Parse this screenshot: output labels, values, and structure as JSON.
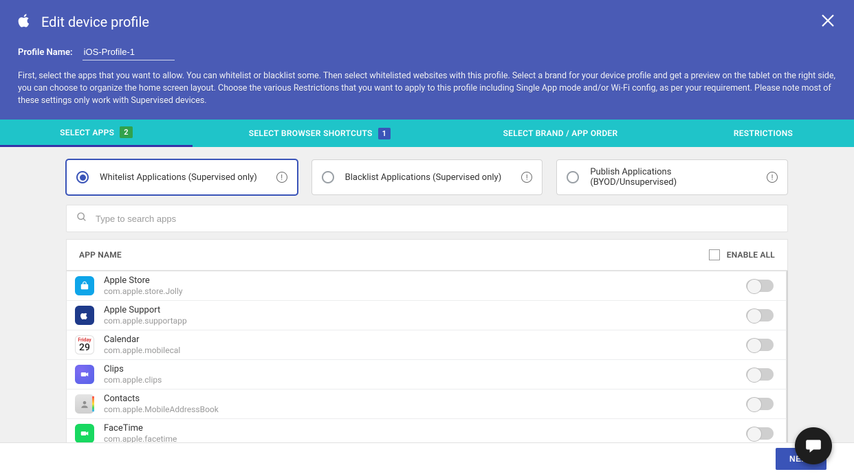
{
  "header": {
    "title": "Edit device profile",
    "profile_label": "Profile Name:",
    "profile_value": "iOS-Profile-1",
    "description": "First, select the apps that you want to allow. You can whitelist or blacklist some. Then select whitelisted websites with this profile. Select a brand for your device profile and get a preview on the tablet on the right side, you can choose to organize the home screen layout. Choose the various Restrictions that you want to apply to this profile including Single App mode and/or Wi-Fi config, as per your requirement. Please note most of these settings only work with Supervised devices."
  },
  "tabs": {
    "t1": {
      "label": "SELECT APPS",
      "badge": "2"
    },
    "t2": {
      "label": "SELECT BROWSER SHORTCUTS",
      "badge": "1"
    },
    "t3": {
      "label": "SELECT BRAND / APP ORDER"
    },
    "t4": {
      "label": "RESTRICTIONS"
    }
  },
  "radio": {
    "whitelist": "Whitelist Applications (Supervised only)",
    "blacklist": "Blacklist Applications (Supervised only)",
    "publish": "Publish Applications (BYOD/Unsupervised)"
  },
  "search": {
    "placeholder": "Type to search apps"
  },
  "table": {
    "col_app": "APP NAME",
    "enable_all": "ENABLE ALL"
  },
  "apps": [
    {
      "name": "Apple Store",
      "id": "com.apple.store.Jolly"
    },
    {
      "name": "Apple Support",
      "id": "com.apple.supportapp"
    },
    {
      "name": "Calendar",
      "id": "com.apple.mobilecal"
    },
    {
      "name": "Clips",
      "id": "com.apple.clips"
    },
    {
      "name": "Contacts",
      "id": "com.apple.MobileAddressBook"
    },
    {
      "name": "FaceTime",
      "id": "com.apple.facetime"
    }
  ],
  "footer": {
    "next": "NEXT"
  },
  "calendar_icon": {
    "friday": "Friday",
    "day": "29"
  }
}
